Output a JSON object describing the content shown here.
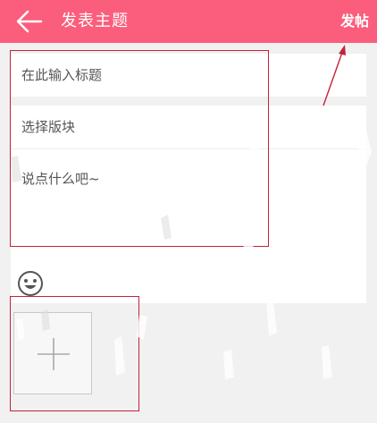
{
  "header": {
    "title": "发表主题",
    "publish_label": "发帖",
    "background_color": "#fb5e7c"
  },
  "form": {
    "title_placeholder": "在此输入标题",
    "section_label": "选择版块",
    "content_placeholder": "说点什么吧~"
  },
  "toolbar": {
    "emoji_icon": "smiley-face-icon"
  },
  "attachments": {
    "add_image_icon": "plus-icon"
  },
  "annotations": {
    "highlight_color": "#c3233b"
  }
}
